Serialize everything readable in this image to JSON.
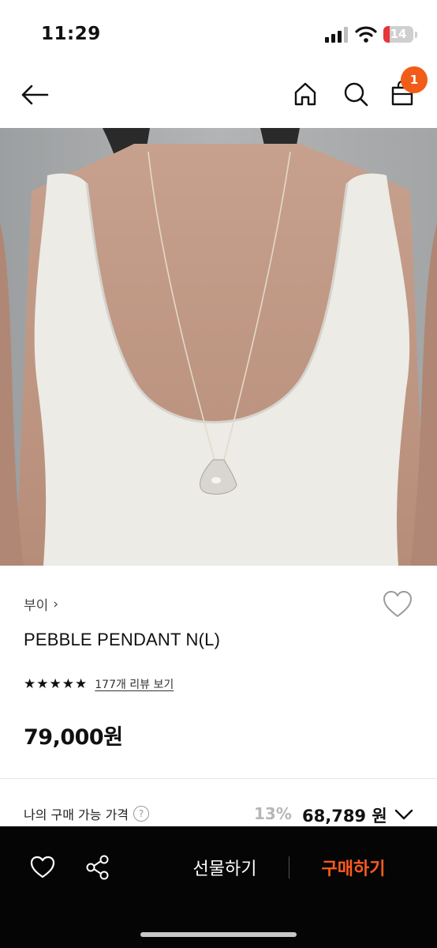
{
  "status_bar": {
    "time": "11:29",
    "battery_level": "14"
  },
  "nav": {
    "icons": [
      "arrow-left-icon",
      "home-icon",
      "search-icon",
      "shopping-bag-icon"
    ],
    "cart_badge": "1",
    "accent_color": "#f25c19"
  },
  "product": {
    "brand": "부이",
    "brand_chevron": "›",
    "name": "PEBBLE PENDANT N(L)",
    "rating": 5,
    "stars": [
      "★",
      "★",
      "★",
      "★",
      "★"
    ],
    "review_link": "177개 리뷰 보기",
    "price": "79,000원"
  },
  "my_price": {
    "label": "나의 구매 가능 가격",
    "help": "?",
    "discount": "13%",
    "price": "68,789 원"
  },
  "bottom_bar": {
    "gift_label": "선물하기",
    "buy_label": "구매하기",
    "buy_color": "#ff5a1f"
  }
}
